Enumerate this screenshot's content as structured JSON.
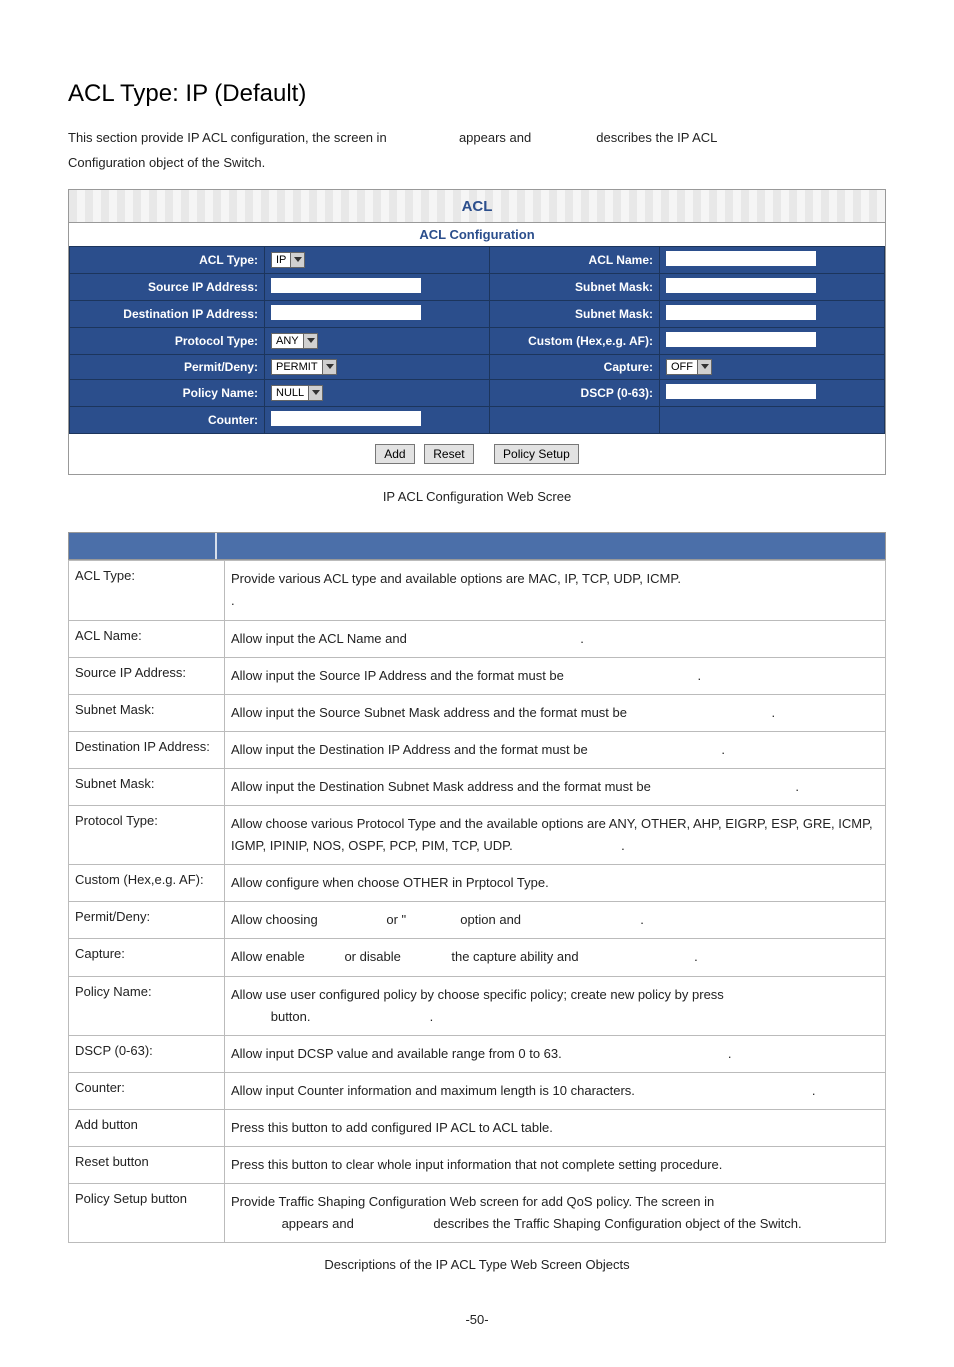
{
  "title": "ACL Type: IP (Default)",
  "intro_line1": "This section provide IP ACL configuration, the screen in",
  "intro_gap1": "appears and",
  "intro_gap2": "describes the IP ACL",
  "intro_line2": "Configuration object of the Switch.",
  "panel": {
    "top": "ACL",
    "sub": "ACL Configuration",
    "rows": {
      "acl_type_label": "ACL Type:",
      "acl_type_value": "IP",
      "acl_name_label": "ACL Name:",
      "src_ip_label": "Source IP Address:",
      "subnet1_label": "Subnet Mask:",
      "dst_ip_label": "Destination IP Address:",
      "subnet2_label": "Subnet Mask:",
      "proto_label": "Protocol Type:",
      "proto_value": "ANY",
      "custom_label": "Custom (Hex,e.g. AF):",
      "permit_label": "Permit/Deny:",
      "permit_value": "PERMIT",
      "capture_label": "Capture:",
      "capture_value": "OFF",
      "policy_label": "Policy Name:",
      "policy_value": "NULL",
      "dscp_label": "DSCP (0-63):",
      "counter_label": "Counter:"
    },
    "buttons": {
      "add": "Add",
      "reset": "Reset",
      "policy_setup": "Policy Setup"
    }
  },
  "figure_caption": "IP ACL Configuration Web Scree",
  "table": [
    {
      "obj": "ACL Type:",
      "desc": "Provide various ACL type and available options are MAC, IP, TCP, UDP, ICMP.\n."
    },
    {
      "obj": "ACL Name:",
      "desc": "Allow input the ACL Name and                                                ."
    },
    {
      "obj": "Source IP Address:",
      "desc": "Allow input the Source IP Address and the format must be                                     ."
    },
    {
      "obj": "Subnet Mask:",
      "desc": "Allow input the Source Subnet Mask address and the format must be                                        ."
    },
    {
      "obj": "Destination IP Address:",
      "desc": "Allow input the Destination IP Address and the format must be                                     ."
    },
    {
      "obj": "Subnet Mask:",
      "desc": "Allow input the Destination Subnet Mask address and the format must be                                        ."
    },
    {
      "obj": "Protocol Type:",
      "desc": "Allow choose various Protocol Type and the available options are ANY, OTHER, AHP, EIGRP, ESP, GRE, ICMP, IGMP, IPINIP, NOS, OSPF, PCP, PIM, TCP, UDP.                              ."
    },
    {
      "obj": "Custom (Hex,e.g. AF):",
      "desc": "Allow configure when choose OTHER in Prptocol Type."
    },
    {
      "obj": "Permit/Deny:",
      "desc": "Allow choosing                   or \"               option and                                 ."
    },
    {
      "obj": "Capture:",
      "desc": "Allow enable           or disable              the capture ability and                                ."
    },
    {
      "obj": "Policy Name:",
      "desc": "Allow use user configured policy by choose specific policy; create new policy by press\n           button.                                 ."
    },
    {
      "obj": "DSCP (0-63):",
      "desc": "Allow input DCSP value and available range from 0 to 63.                                              ."
    },
    {
      "obj": "Counter:",
      "desc": "Allow input Counter information and maximum length is 10 characters.                                                 ."
    },
    {
      "obj": "Add button",
      "desc": "Press this button to add configured IP ACL to ACL table."
    },
    {
      "obj": "Reset button",
      "desc": "Press this button to clear whole input information that not complete setting procedure."
    },
    {
      "obj": "Policy Setup button",
      "desc": "Provide Traffic Shaping Configuration Web screen for add QoS policy. The screen in\n              appears and                      describes the Traffic Shaping Configuration object of the Switch."
    }
  ],
  "table_caption": "Descriptions of the IP ACL Type Web Screen Objects",
  "page_number": "-50-"
}
